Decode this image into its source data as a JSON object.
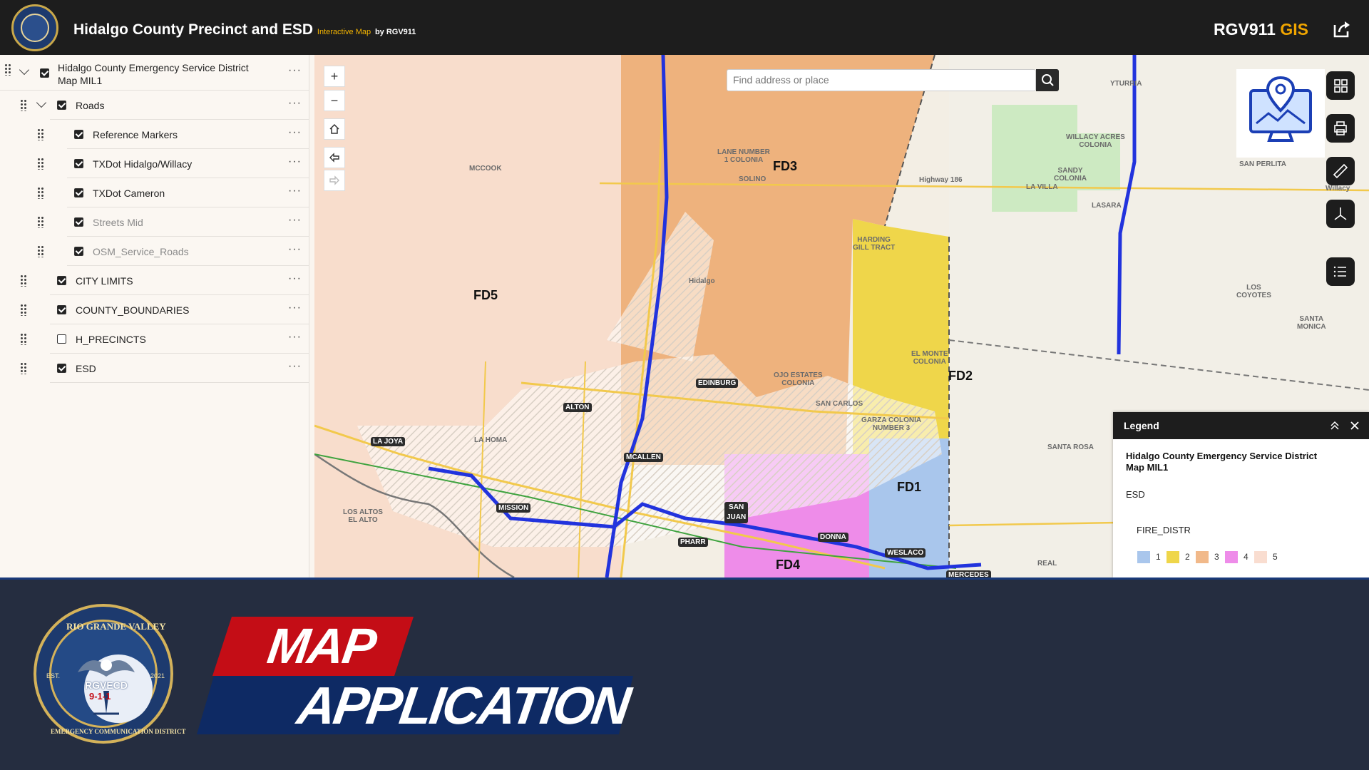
{
  "header": {
    "title": "Hidalgo County Precinct and ESD",
    "subtitle": "Interactive Map",
    "by": "by RGV911",
    "brand_main": "RGV911",
    "brand_accent": "GIS"
  },
  "layers": [
    {
      "label": "Hidalgo County Emergency Service District",
      "label2": "Map MIL1",
      "checked": true,
      "level": 0,
      "expanded": true
    },
    {
      "label": "Roads",
      "checked": true,
      "level": 1,
      "expanded": true
    },
    {
      "label": "Reference Markers",
      "checked": true,
      "level": 2
    },
    {
      "label": "TXDot Hidalgo/Willacy",
      "checked": true,
      "level": 2
    },
    {
      "label": "TXDot Cameron",
      "checked": true,
      "level": 2
    },
    {
      "label": "Streets Mid",
      "checked": true,
      "level": 2,
      "dim": true
    },
    {
      "label": "OSM_Service_Roads",
      "checked": true,
      "level": 2,
      "dim": true
    },
    {
      "label": "CITY LIMITS",
      "checked": true,
      "level": 1
    },
    {
      "label": "COUNTY_BOUNDARIES",
      "checked": true,
      "level": 1
    },
    {
      "label": "H_PRECINCTS",
      "checked": false,
      "level": 1
    },
    {
      "label": "ESD",
      "checked": true,
      "level": 1
    }
  ],
  "search": {
    "placeholder": "Find address or place"
  },
  "controls": {
    "zoom_in": "+",
    "zoom_out": "−"
  },
  "fire_districts": {
    "fd1": "FD1",
    "fd2": "FD2",
    "fd3": "FD3",
    "fd4": "FD4",
    "fd5": "FD5"
  },
  "cities": {
    "la_joya": "LA JOYA",
    "alton": "ALTON",
    "mission": "MISSION",
    "mcallen": "MCALLEN",
    "edinburg": "EDINBURG",
    "san_juan": "SAN\nJUAN",
    "pharr": "PHARR",
    "donna": "DONNA",
    "weslaco": "WESLACO",
    "mercedes": "MERCEDES"
  },
  "towns": {
    "mccook": "MCCOOK",
    "lane_number": "LANE NUMBER\n1 COLONIA",
    "solino": "SOLINO",
    "harding": "HARDING\nGILL TRACT",
    "hidalgo": "Hidalgo",
    "el_monte": "EL MONTE\nCOLONIA",
    "garza": "GARZA COLONIA\nNUMBER 3",
    "ojo": "OJO ESTATES\nCOLONIA",
    "san_carlos": "SAN CARLOS",
    "la_homa": "LA HOMA",
    "los_altos": "LOS ALTOS\nEL ALTO",
    "willacy": "WILLACY ACRES\nCOLONIA",
    "sandy": "SANDY\nCOLONIA",
    "lasara": "LASARA",
    "yturria": "YTURRIA",
    "san_perlita": "SAN PERLITA",
    "los_coyotes": "LOS\nCOYOTES",
    "santa_monica": "SANTA\nMONICA",
    "santa_rosa": "SANTA ROSA",
    "willacy2": "Willacy",
    "highway": "Highway 186",
    "la_villa": "LA VILLA",
    "real": "REAL"
  },
  "legend": {
    "title": "Legend",
    "layer": "Hidalgo County Emergency Service District",
    "layer2": "Map MIL1",
    "sublayer": "ESD",
    "field": "FIRE_DISTR",
    "items": [
      {
        "label": "1",
        "color": "#a9c6ec"
      },
      {
        "label": "2",
        "color": "#efd64a"
      },
      {
        "label": "3",
        "color": "#f1b98a"
      },
      {
        "label": "4",
        "color": "#ee8ce9"
      },
      {
        "label": "5",
        "color": "#f9ddd0"
      }
    ]
  },
  "banner": {
    "line1": "MAP",
    "line2": "APPLICATION",
    "seal_top": "RIO GRANDE VALLEY",
    "seal_bottom": "EMERGENCY COMMUNICATION DISTRICT",
    "seal_center": "RGVECD",
    "seal_number": "9-1-1",
    "seal_est": "EST.",
    "seal_year": "2021"
  },
  "colors": {
    "fd1": "#a9c6ec",
    "fd2": "#efd64a",
    "fd3": "#eeb27d",
    "fd4": "#ee8ce9",
    "fd5": "#f8ddcc",
    "highway": "#2233dd",
    "banner_bg": "#252d40",
    "accent_red": "#c40d16",
    "accent_navy": "#0e2a64"
  }
}
